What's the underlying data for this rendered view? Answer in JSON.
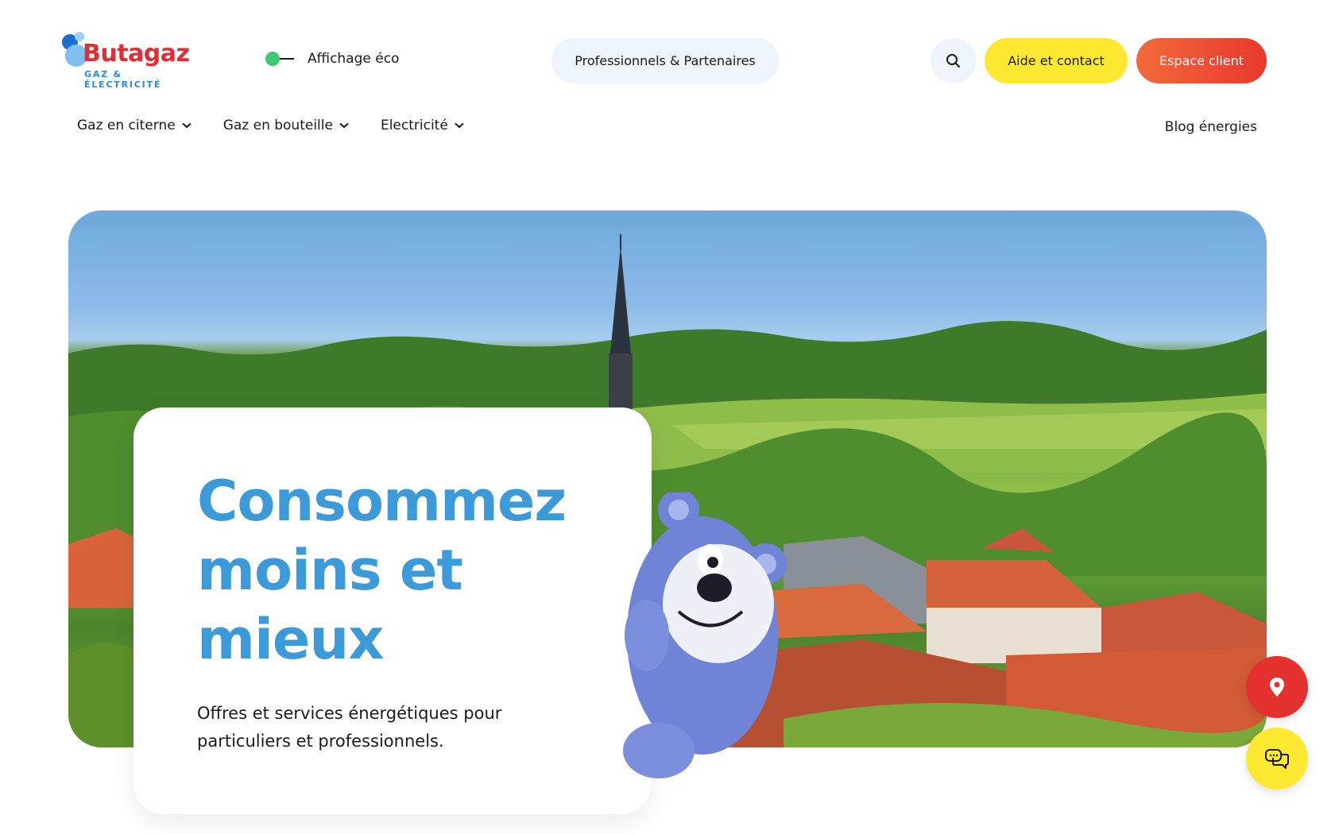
{
  "header": {
    "brand": "Butagaz",
    "tagline": "GAZ & ÉLECTRICITÉ",
    "eco_toggle_label": "Affichage éco",
    "pro_button": "Professionnels & Partenaires",
    "search_icon": "search-icon",
    "help_button": "Aide et contact",
    "client_button": "Espace client"
  },
  "nav": {
    "items": [
      {
        "label": "Gaz en citerne",
        "icon": "chevron-down-icon"
      },
      {
        "label": "Gaz en bouteille",
        "icon": "chevron-down-icon"
      },
      {
        "label": "Electricité",
        "icon": "chevron-down-icon"
      }
    ],
    "blog": "Blog énergies"
  },
  "hero": {
    "title": "Consommez moins et mieux",
    "subtitle": "Offres et services énergétiques pour particuliers et professionnels."
  },
  "floating": {
    "location_icon": "location-pin-icon",
    "chat_icon": "chat-bubbles-icon"
  },
  "colors": {
    "brand_red": "#e32d35",
    "brand_blue": "#3c9ad8",
    "help_yellow": "#fde832",
    "client_orange": "#ec4a32",
    "eco_green": "#3dc873"
  }
}
